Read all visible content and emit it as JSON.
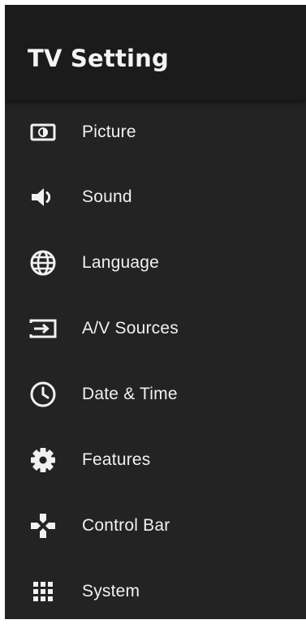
{
  "header": {
    "title": "TV Setting"
  },
  "menu": {
    "items": [
      {
        "label": "Picture",
        "icon": "picture-icon"
      },
      {
        "label": "Sound",
        "icon": "speaker-icon"
      },
      {
        "label": "Language",
        "icon": "globe-icon"
      },
      {
        "label": "A/V Sources",
        "icon": "input-source-icon"
      },
      {
        "label": "Date & Time",
        "icon": "clock-icon"
      },
      {
        "label": "Features",
        "icon": "gear-icon"
      },
      {
        "label": "Control Bar",
        "icon": "gamepad-icon"
      },
      {
        "label": "System",
        "icon": "grid-icon"
      }
    ]
  },
  "colors": {
    "panel_background": "#232323",
    "header_background": "#1b1b1b",
    "text": "#f1f1f1"
  }
}
